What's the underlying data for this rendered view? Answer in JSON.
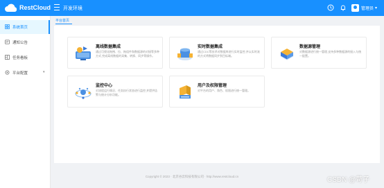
{
  "header": {
    "brand": "RestCloud",
    "env_title": "开发环境",
    "user_name": "管理员",
    "accent": "#1890ff"
  },
  "sidebar": {
    "items": [
      {
        "label": "系统首页",
        "icon": "home-icon",
        "active": true
      },
      {
        "label": "通知公告",
        "icon": "notice-icon"
      },
      {
        "label": "任务看板",
        "icon": "board-icon"
      },
      {
        "label": "平台配置",
        "icon": "settings-icon",
        "has_children": true
      }
    ]
  },
  "breadcrumb": "平台首页",
  "cards": [
    {
      "title": "离线数据集成",
      "desc": "通过可视化拖拽、拉、拖组件和数据源的对接等多种方式,完成离线数据的采集、转换、同步等操作。"
    },
    {
      "title": "实时数据集成",
      "desc": "通过CDC等技术对数据库进行实时监控,并以实时流的方式将数据同步到目标端。"
    },
    {
      "title": "数据源管理",
      "desc": "对数据源进行统一管理,支持多种数据源的接入与统一配置。"
    },
    {
      "title": "监控中心",
      "desc": "对流程运行情况、任务执行状态进行监控,并提供告警与统计分析功能。"
    },
    {
      "title": "用户及权限管理",
      "desc": "对平台的用户、角色、权限进行统一管理。"
    }
  ],
  "footer": "Copyright © 2023 · 北京谷云科技有限公司 · http://www.restcloud.cn",
  "watermark": "CSDN @苛子"
}
